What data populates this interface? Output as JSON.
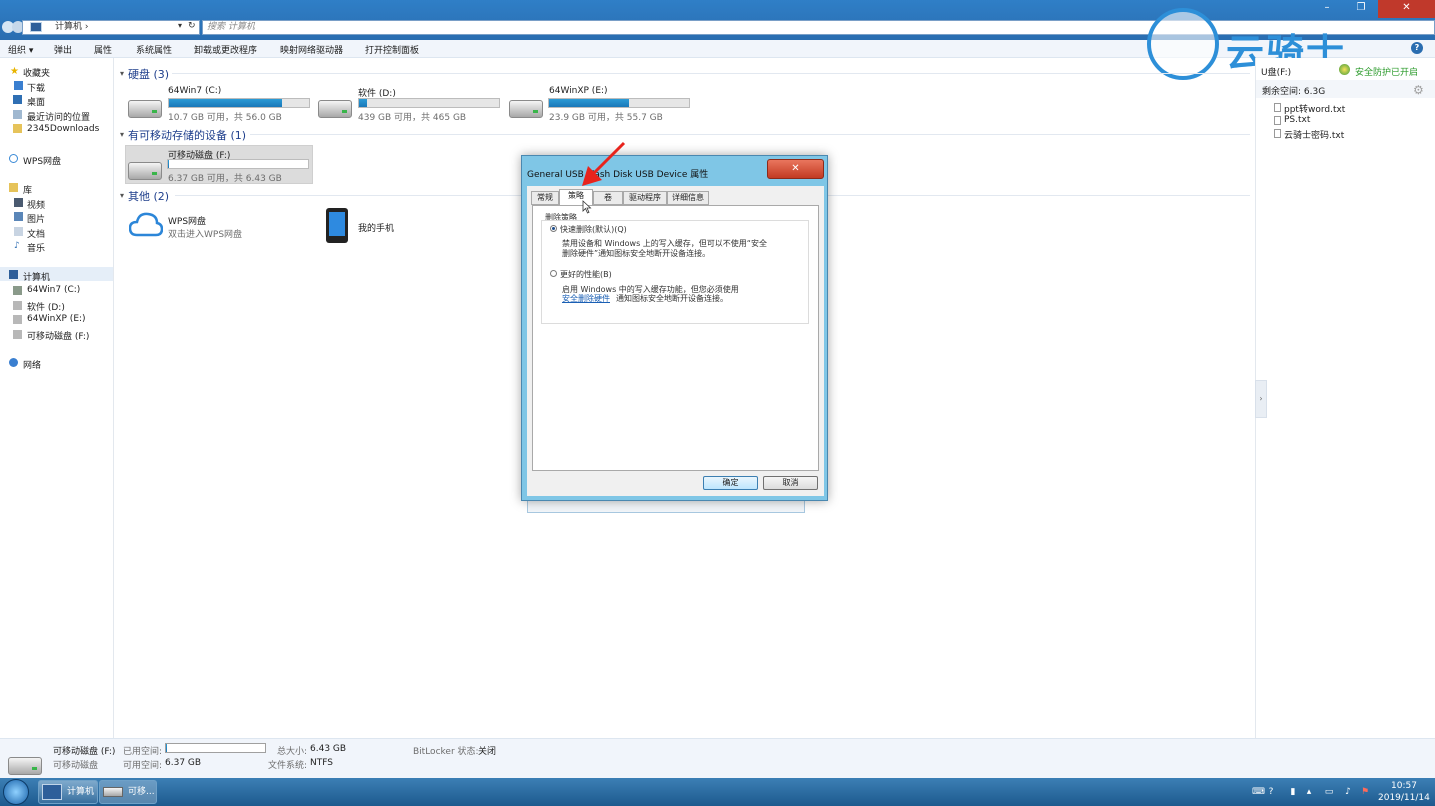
{
  "window": {
    "address_parts": [
      "计算机",
      "›"
    ],
    "search_placeholder": "搜索 计算机",
    "minimize": "–",
    "maximize": "❐",
    "close": "✕"
  },
  "toolbar": {
    "organize": "组织 ▾",
    "eject": "弹出",
    "properties": "属性",
    "system_properties": "系统属性",
    "uninstall": "卸载或更改程序",
    "map_drive": "映射网络驱动器",
    "control_panel": "打开控制面板",
    "help": "?"
  },
  "logo": {
    "text": "云骑士"
  },
  "sidebar": {
    "favorites": "收藏夹",
    "downloads": "下载",
    "desktop": "桌面",
    "recent": "最近访问的位置",
    "downloads2345": "2345Downloads",
    "wps_disk": "WPS网盘",
    "libraries": "库",
    "videos": "视频",
    "pictures": "图片",
    "documents": "文档",
    "music": "音乐",
    "computer": "计算机",
    "drive_c": "64Win7  (C:)",
    "drive_d": "软件 (D:)",
    "drive_e": "64WinXP  (E:)",
    "drive_f": "可移动磁盘 (F:)",
    "network": "网络"
  },
  "main": {
    "hdd_group": "硬盘 (3)",
    "removable_group": "有可移动存储的设备 (1)",
    "other_group": "其他 (2)",
    "drives": [
      {
        "name": "64Win7  (C:)",
        "info": "10.7 GB 可用，共 56.0 GB",
        "used": 0.81
      },
      {
        "name": "软件 (D:)",
        "info": "439 GB 可用，共 465 GB",
        "used": 0.06
      },
      {
        "name": "64WinXP  (E:)",
        "info": "23.9 GB 可用，共 55.7 GB",
        "used": 0.57
      }
    ],
    "removable": {
      "name": "可移动磁盘 (F:)",
      "info": "6.37 GB 可用，共 6.43 GB",
      "used": 0.01
    },
    "wps": {
      "name": "WPS网盘",
      "desc": "双击进入WPS网盘"
    },
    "phone": {
      "name": "我的手机"
    }
  },
  "preview": {
    "drive": "U盘(F:)",
    "protection": "安全防护已开启",
    "free_space": "剩余空间: 6.3G",
    "files": [
      "ppt转word.txt",
      "PS.txt",
      "云骑士密码.txt"
    ],
    "collapse": "›"
  },
  "dialog": {
    "title": "General USB Flash Disk USB Device 属性",
    "close": "✕",
    "tabs": [
      "常规",
      "策略",
      "卷",
      "驱动程序",
      "详细信息"
    ],
    "section": "删除策略",
    "quick_label": "快速删除(默认)(Q)",
    "quick_desc_1": "禁用设备和 Windows 上的写入缓存，但可以不使用“安全",
    "quick_desc_2": "删除硬件”通知图标安全地断开设备连接。",
    "better_label": "更好的性能(B)",
    "better_desc_1": "启用 Windows 中的写入缓存功能，但您必须使用",
    "better_link": "安全删除硬件",
    "better_desc_2": "通知图标安全地断开设备连接。",
    "ok": "确定",
    "cancel": "取消"
  },
  "details": {
    "name": "可移动磁盘 (F:)",
    "used_label": "已用空间:",
    "total_label": "总大小:",
    "total": "6.43 GB",
    "bitlocker_label": "BitLocker 状态:",
    "bitlocker": "关闭",
    "type": "可移动磁盘",
    "free_label": "可用空间:",
    "free": "6.37 GB",
    "fs_label": "文件系统:",
    "fs": "NTFS",
    "used_fraction": 0.01
  },
  "taskbar": {
    "btn_computer": "计算机",
    "btn_removable": "可移...",
    "time": "10:57",
    "date": "2019/11/14"
  },
  "colors": {
    "accent": "#2a6db0",
    "bar": "#1a78b8",
    "logo": "#2d8fd8"
  }
}
